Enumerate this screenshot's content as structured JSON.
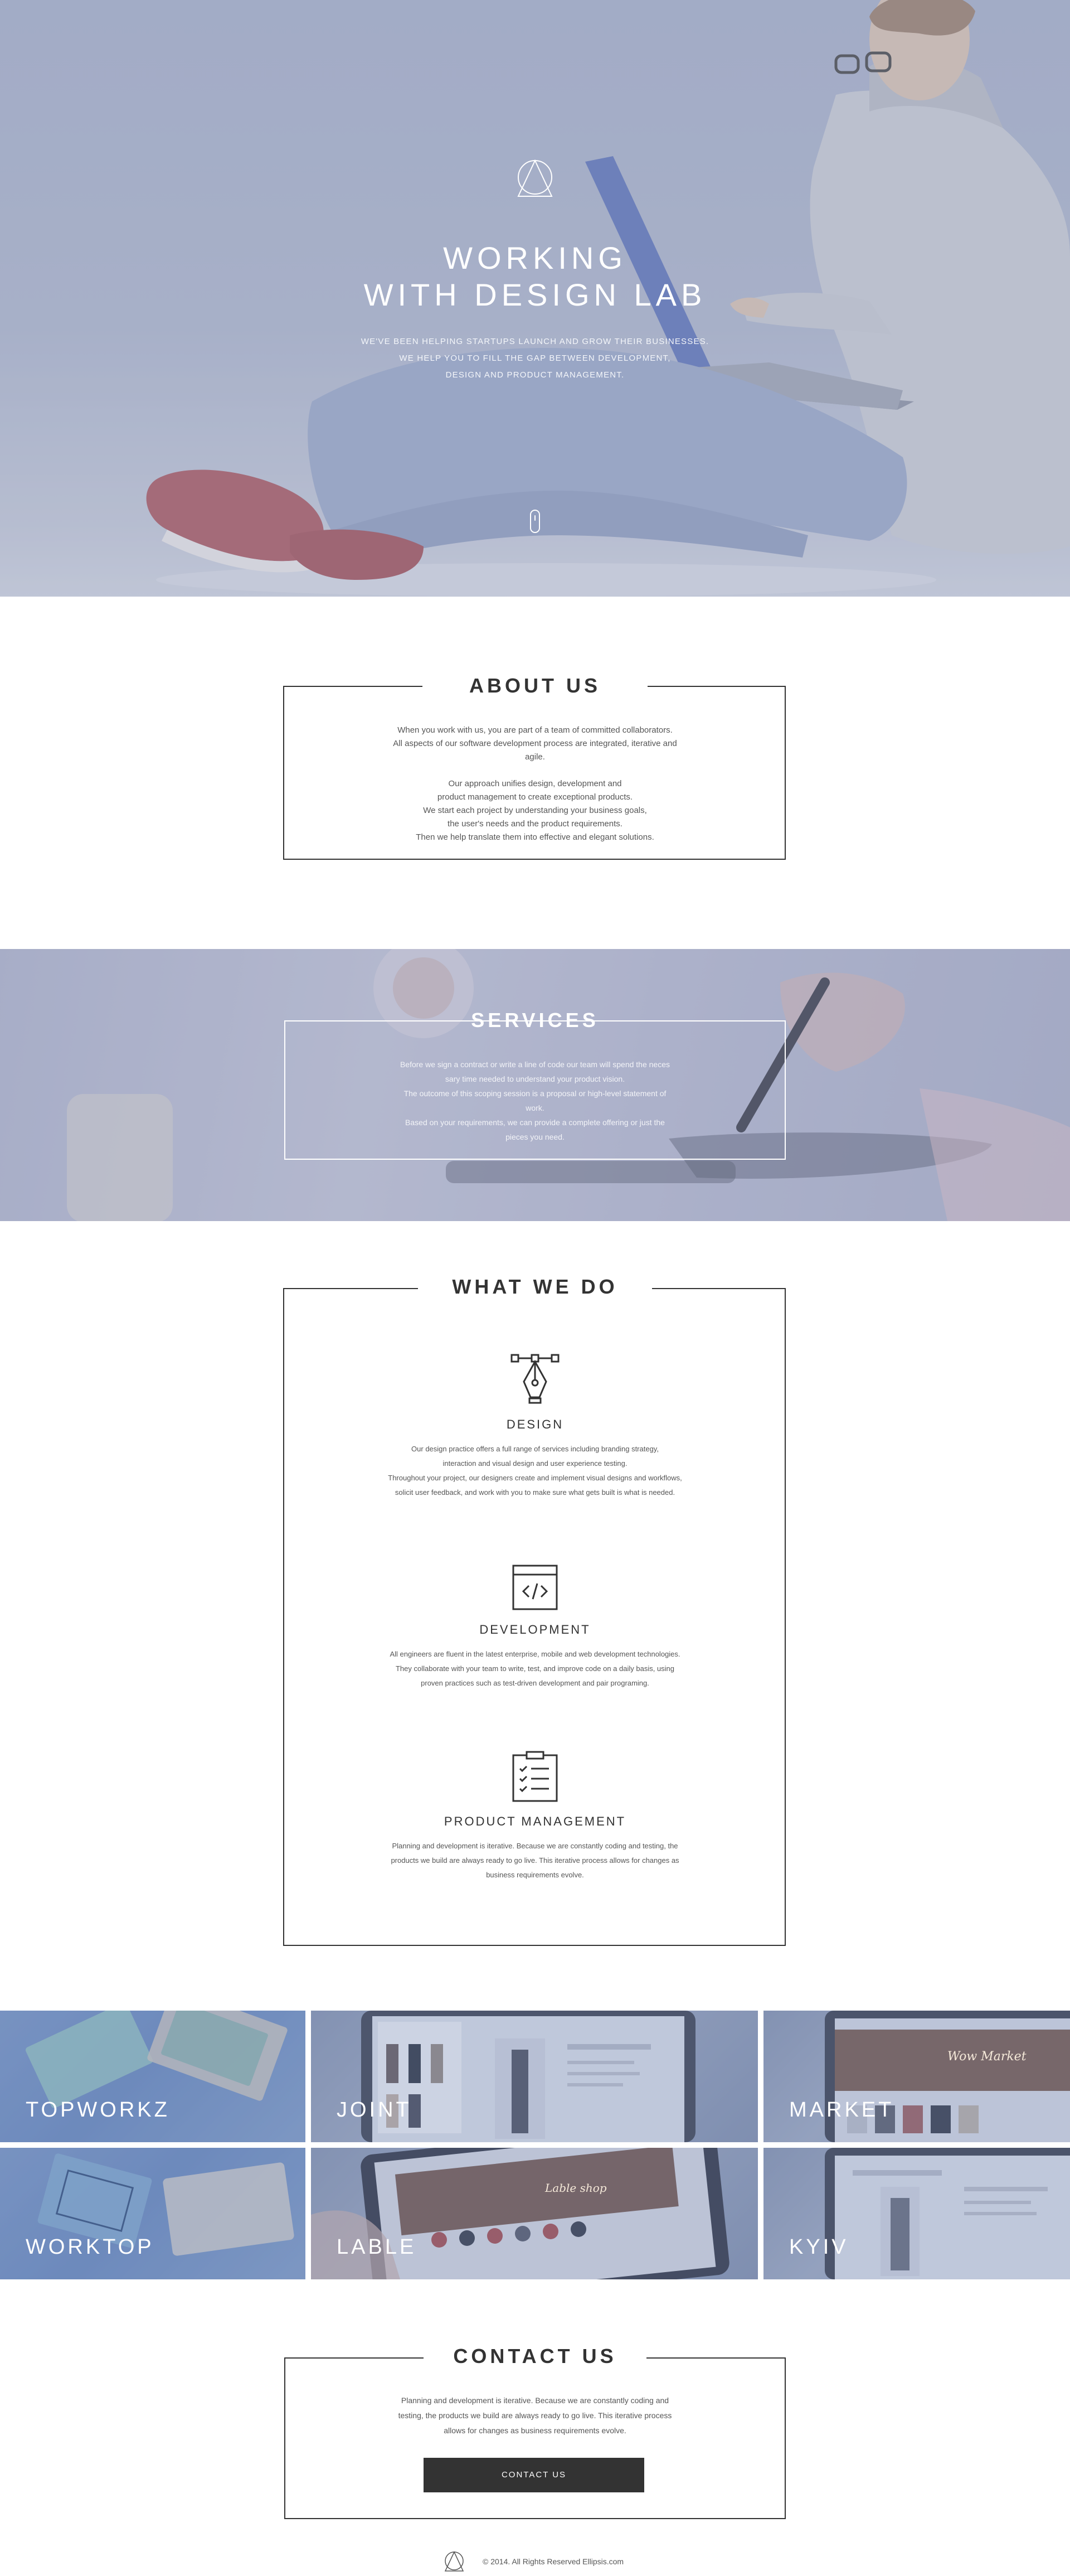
{
  "hero": {
    "title_line1": "WORKING",
    "title_line2": "WITH DESIGN LAB",
    "subtitle_line1": "WE'VE BEEN HELPING STARTUPS LAUNCH AND GROW THEIR BUSINESSES.",
    "subtitle_line2": "WE HELP YOU TO FILL THE GAP BETWEEN DEVELOPMENT,",
    "subtitle_line3": "DESIGN AND PRODUCT MANAGEMENT.",
    "logo_icon": "triangle-circle-logo-icon",
    "scroll_icon": "mouse-scroll-icon"
  },
  "about": {
    "title": "ABOUT US",
    "lines": [
      "When you work with us, you are part of a team of committed collaborators.",
      "All aspects of our software development process are integrated, iterative and",
      "agile.",
      "",
      "Our approach unifies design, development and",
      "product management to create exceptional products.",
      "We start each project by understanding your business goals,",
      "the user's needs and the product requirements.",
      "Then we help translate them into effective and elegant solutions."
    ]
  },
  "services": {
    "title": "SERVICES",
    "lines": [
      "Before we sign a contract or write a line of code our team will spend the neces",
      "sary time needed to understand your product vision.",
      "The outcome of this scoping session is a proposal or high-level statement of",
      "work.",
      "Based on your requirements, we can provide a complete offering or just the",
      "pieces you need."
    ]
  },
  "what_we_do": {
    "title": "WHAT WE DO",
    "items": [
      {
        "icon": "pen-tool-icon",
        "heading": "DESIGN",
        "lines": [
          "Our design practice offers a full range of services including branding strategy,",
          "interaction and visual design and user experience testing.",
          "Throughout your project, our designers create and implement visual designs and workflows,",
          "solicit user feedback, and work with you to make sure what gets built is what is needed."
        ]
      },
      {
        "icon": "code-window-icon",
        "heading": "DEVELOPMENT",
        "lines": [
          "All engineers are fluent in the latest enterprise, mobile and web development technologies.",
          "They collaborate with your team to write, test, and improve code on a daily basis, using",
          "proven practices such as test-driven development and pair programing."
        ]
      },
      {
        "icon": "clipboard-checklist-icon",
        "heading": "PRODUCT MANAGEMENT",
        "lines": [
          "Planning and development is iterative. Because we are constantly coding and testing, the",
          "products we build are always ready to go live. This iterative process allows for changes as",
          "business requirements evolve."
        ]
      }
    ]
  },
  "portfolio": {
    "tiles": [
      {
        "label": "TOPWORKZ"
      },
      {
        "label": "JOINT"
      },
      {
        "label": "MARKET"
      },
      {
        "label": "WORKTOP"
      },
      {
        "label": "LABLE"
      },
      {
        "label": "KYIV"
      }
    ],
    "overlay_texts": {
      "market_screen": "Wow Market",
      "lable_screen": "Lable shop"
    }
  },
  "contact": {
    "title": "CONTACT US",
    "lines": [
      "Planning and development is iterative. Because we are constantly coding and",
      "testing, the products we build are always ready to go live. This iterative process",
      "allows for changes as business requirements evolve."
    ],
    "button_label": "CONTACT US"
  },
  "footer": {
    "copyright": "© 2014. All Rights Reserved Ellipsis.com",
    "logo_icon": "triangle-circle-logo-icon"
  },
  "colors": {
    "hero_tint": "#a7b0c8",
    "text_dark": "#333333",
    "button_bg": "#333333",
    "tile_blue": "#7e9ccb"
  }
}
